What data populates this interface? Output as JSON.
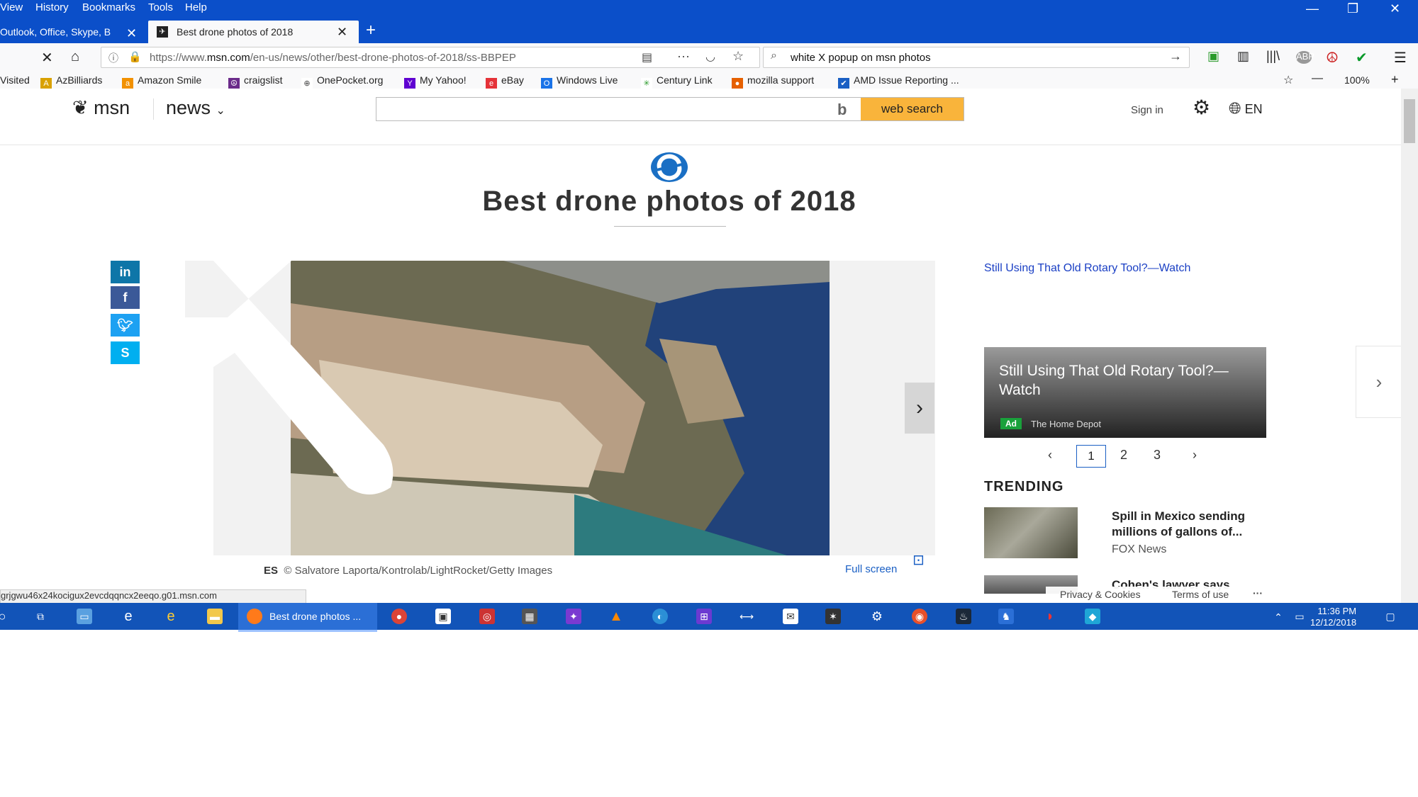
{
  "browser": {
    "menu": [
      "View",
      "History",
      "Bookmarks",
      "Tools",
      "Help"
    ],
    "tabs": [
      {
        "label": "Outlook, Office, Skype, B"
      },
      {
        "label": "Best drone photos of 2018"
      }
    ],
    "url_prefix": "https://www.",
    "url_domain": "msn.com",
    "url_rest": "/en-us/news/other/best-drone-photos-of-2018/ss-BBPEP",
    "search_query": "white X popup on msn photos",
    "zoom": "100%",
    "bookmarks": [
      "Visited",
      "AzBilliards",
      "Amazon Smile",
      "craigslist",
      "OnePocket.org",
      "My Yahoo!",
      "eBay",
      "Windows Live",
      "Century Link",
      "mozilla support",
      "AMD Issue Reporting ..."
    ]
  },
  "msn": {
    "logo": "msn",
    "section": "news",
    "search_button": "web search",
    "sign_in": "Sign in",
    "lang": "EN"
  },
  "article": {
    "title": "Best drone photos of 2018",
    "caption_prefix": "ES",
    "caption": "© Salvatore Laporta/Kontrolab/LightRocket/Getty Images",
    "full_screen": "Full screen"
  },
  "ad": {
    "link": "Still Using That Old Rotary Tool?—Watch",
    "card_title": "Still Using That Old Rotary Tool?—Watch",
    "badge": "Ad",
    "source": "The Home Depot",
    "pages": [
      "1",
      "2",
      "3"
    ]
  },
  "trending": {
    "heading": "TRENDING",
    "items": [
      {
        "headline": "Spill in Mexico sending millions of gallons of...",
        "source": "FOX News"
      },
      {
        "headline": "Cohen's lawyer says",
        "source": ""
      }
    ]
  },
  "status": {
    "url": "grjgwu46x24kocigux2evcdqqncx2eeqo.g01.msn.com",
    "privacy": "Privacy & Cookies",
    "terms": "Terms of use",
    "more": "···"
  },
  "taskbar": {
    "active_label": "Best drone photos ...",
    "time": "11:36 PM",
    "date": "12/12/2018"
  }
}
